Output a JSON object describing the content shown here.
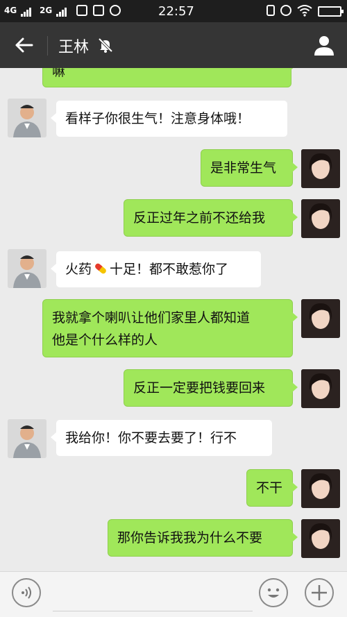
{
  "status_bar": {
    "network_1": "4G",
    "network_2": "2G",
    "time": "22:57"
  },
  "header": {
    "title": "王林",
    "back_icon": "arrow-left-icon",
    "mute_icon": "bell-muted-icon",
    "profile_icon": "person-icon"
  },
  "messages": [
    {
      "side": "out",
      "text": "嘛"
    },
    {
      "side": "in",
      "text": "看样子你很生气！注意身体哦！"
    },
    {
      "side": "out",
      "text": "是非常生气"
    },
    {
      "side": "out",
      "text": "反正过年之前不还给我"
    },
    {
      "side": "in",
      "text_before": "火药",
      "emoji": "pill-emoji",
      "text_after": "十足！都不敢惹你了"
    },
    {
      "side": "out",
      "line1": "我就拿个喇叭让他们家里人都知道",
      "line2": "他是个什么样的人"
    },
    {
      "side": "out",
      "text": "反正一定要把钱要回来"
    },
    {
      "side": "in",
      "text": "我给你！你不要去要了！行不"
    },
    {
      "side": "out",
      "text": "不干"
    },
    {
      "side": "out",
      "text": "那你告诉我我为什么不要"
    }
  ],
  "input_bar": {
    "voice_icon": "voice-icon",
    "emoji_icon": "smiley-icon",
    "more_icon": "plus-icon",
    "placeholder": ""
  },
  "colors": {
    "header_bg": "#353535",
    "statusbar_bg": "#1e1e1e",
    "chat_bg": "#ebebeb",
    "outgoing_bubble": "#a0e75a",
    "incoming_bubble": "#ffffff"
  }
}
